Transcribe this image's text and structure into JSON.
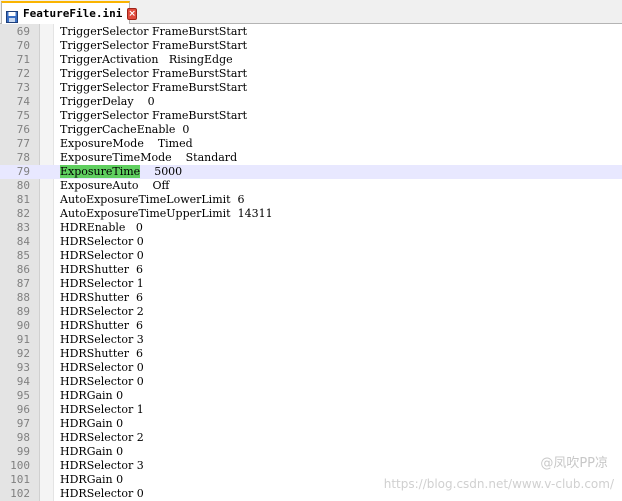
{
  "tab": {
    "title": "FeatureFile.ini",
    "icon": "save-disk-icon",
    "close_icon": "close-icon",
    "accent": "#fab400"
  },
  "editor": {
    "current_line": 79,
    "highlight_color": "#5fcf5f",
    "lines": [
      {
        "n": "69",
        "text": "TriggerSelector FrameBurstStart"
      },
      {
        "n": "70",
        "text": "TriggerSelector FrameBurstStart"
      },
      {
        "n": "71",
        "text": "TriggerActivation   RisingEdge"
      },
      {
        "n": "72",
        "text": "TriggerSelector FrameBurstStart"
      },
      {
        "n": "73",
        "text": "TriggerSelector FrameBurstStart"
      },
      {
        "n": "74",
        "text": "TriggerDelay    0"
      },
      {
        "n": "75",
        "text": "TriggerSelector FrameBurstStart"
      },
      {
        "n": "76",
        "text": "TriggerCacheEnable  0"
      },
      {
        "n": "77",
        "text": "ExposureMode    Timed"
      },
      {
        "n": "78",
        "text": "ExposureTimeMode    Standard"
      },
      {
        "n": "79",
        "highlight": "ExposureTime",
        "text": "    5000"
      },
      {
        "n": "80",
        "text": "ExposureAuto    Off"
      },
      {
        "n": "81",
        "text": "AutoExposureTimeLowerLimit  6"
      },
      {
        "n": "82",
        "text": "AutoExposureTimeUpperLimit  14311"
      },
      {
        "n": "83",
        "text": "HDREnable   0"
      },
      {
        "n": "84",
        "text": "HDRSelector 0"
      },
      {
        "n": "85",
        "text": "HDRSelector 0"
      },
      {
        "n": "86",
        "text": "HDRShutter  6"
      },
      {
        "n": "87",
        "text": "HDRSelector 1"
      },
      {
        "n": "88",
        "text": "HDRShutter  6"
      },
      {
        "n": "89",
        "text": "HDRSelector 2"
      },
      {
        "n": "90",
        "text": "HDRShutter  6"
      },
      {
        "n": "91",
        "text": "HDRSelector 3"
      },
      {
        "n": "92",
        "text": "HDRShutter  6"
      },
      {
        "n": "93",
        "text": "HDRSelector 0"
      },
      {
        "n": "94",
        "text": "HDRSelector 0"
      },
      {
        "n": "95",
        "text": "HDRGain 0"
      },
      {
        "n": "96",
        "text": "HDRSelector 1"
      },
      {
        "n": "97",
        "text": "HDRGain 0"
      },
      {
        "n": "98",
        "text": "HDRSelector 2"
      },
      {
        "n": "99",
        "text": "HDRGain 0"
      },
      {
        "n": "100",
        "text": "HDRSelector 3"
      },
      {
        "n": "101",
        "text": "HDRGain 0"
      },
      {
        "n": "102",
        "text": "HDRSelector 0"
      }
    ]
  },
  "watermark": {
    "line1": "@凤吹PP凉",
    "line2": "https://blog.csdn.net/www.v-club.com/"
  }
}
